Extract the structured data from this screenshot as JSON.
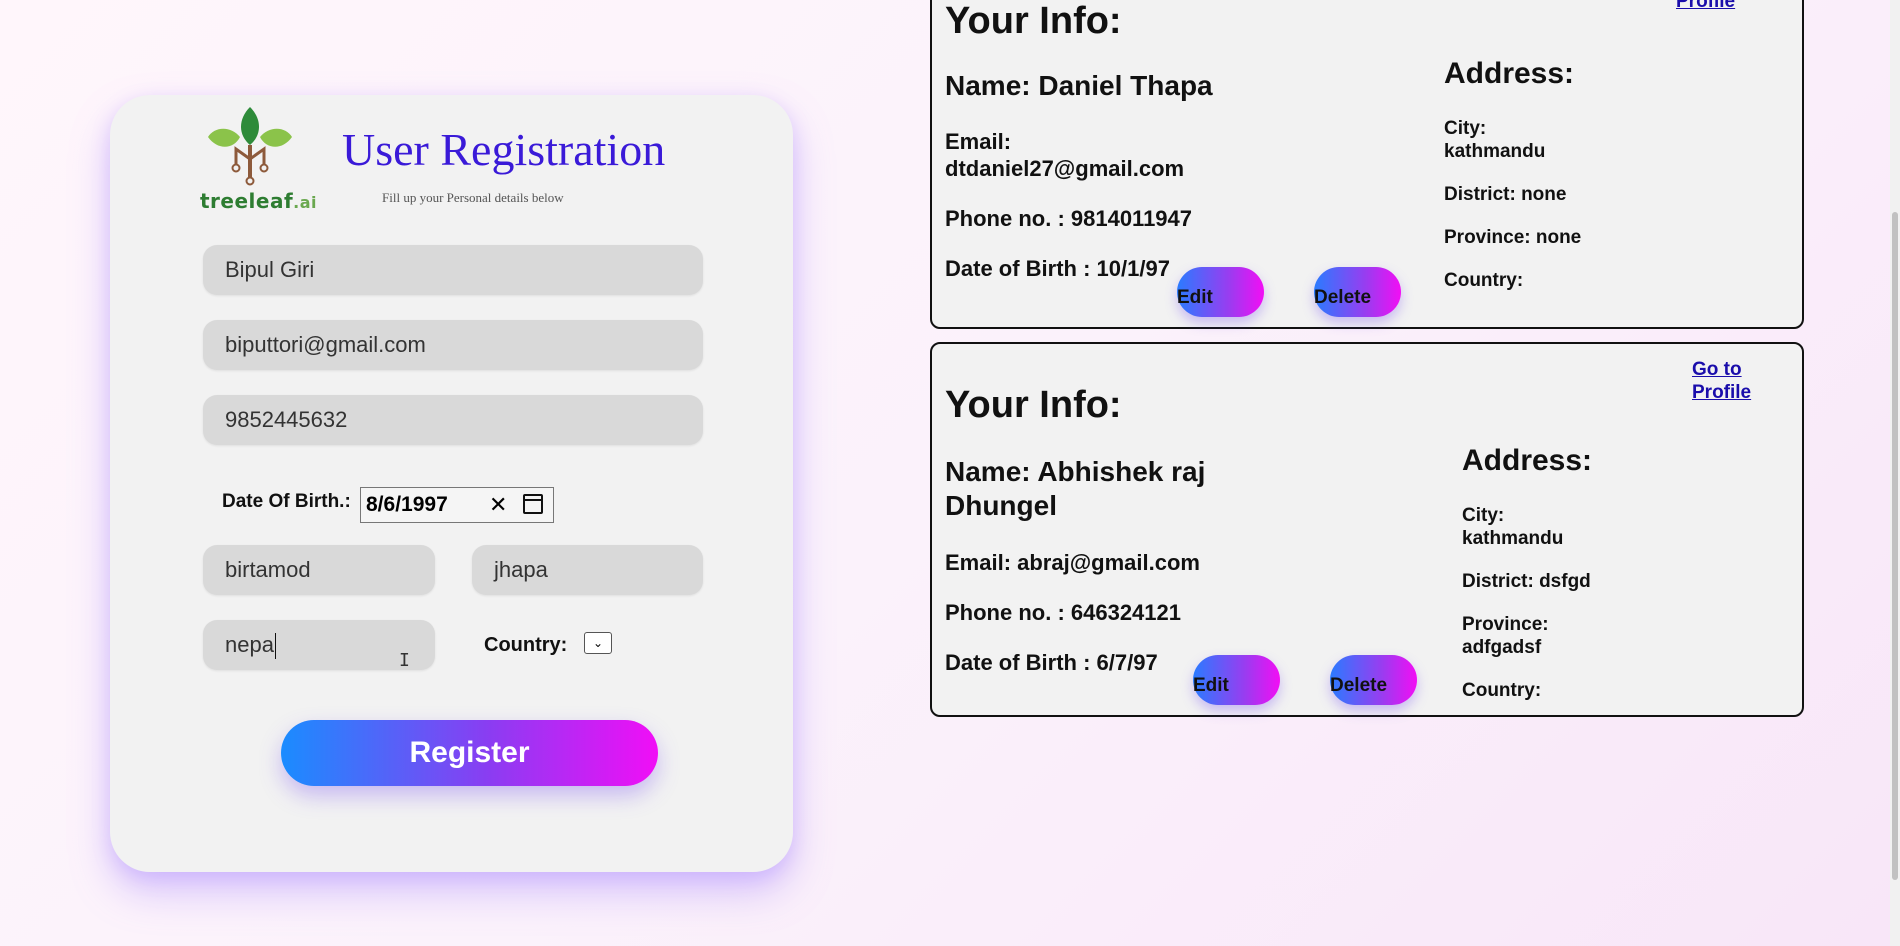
{
  "registration": {
    "logo_text": "treeleaf",
    "logo_suffix": ".ai",
    "title": "User Registration",
    "subtitle": "Fill up your Personal details below",
    "name_value": "Bipul Giri",
    "email_value": "biputtori@gmail.com",
    "phone_value": "9852445632",
    "dob_label": "Date Of Birth.:",
    "dob_value": "8/6/1997",
    "dob_clear": "✕",
    "city_value": "birtamod",
    "district_value": "jhapa",
    "province_value": "nepa",
    "country_label": "Country:",
    "country_select": "⌄",
    "register_label": "Register"
  },
  "cards": [
    {
      "title": "Your Info:",
      "profile_link": "Profile",
      "name": "Name: Daniel Thapa",
      "email_label": "Email:",
      "email": "dtdaniel27@gmail.com",
      "phone": "Phone no. : 9814011947",
      "dob": "Date of Birth : 10/1/97",
      "address_title": "Address:",
      "city_label": "City:",
      "city": "kathmandu",
      "district": "District: none",
      "province": "Province: none",
      "country": "Country:",
      "edit_label": "Edit",
      "delete_label": "Delete"
    },
    {
      "title": "Your Info:",
      "profile_link_1": "Go to",
      "profile_link_2": "Profile",
      "name": "Name: Abhishek raj Dhungel",
      "email": "Email: abraj@gmail.com",
      "phone": "Phone no. : 646324121",
      "dob": "Date of Birth : 6/7/97",
      "address_title": "Address:",
      "city_label": "City:",
      "city": "kathmandu",
      "district": "District: dsfgd",
      "province_label": "Province:",
      "province": "adfgadsf",
      "country": "Country:",
      "edit_label": "Edit",
      "delete_label": "Delete"
    }
  ],
  "colors": {
    "title": "#3a1ad8",
    "gradient_start": "#1a8cff",
    "gradient_end": "#f10ef6",
    "link": "#1a0dab",
    "logo_green": "#2e7d32"
  }
}
